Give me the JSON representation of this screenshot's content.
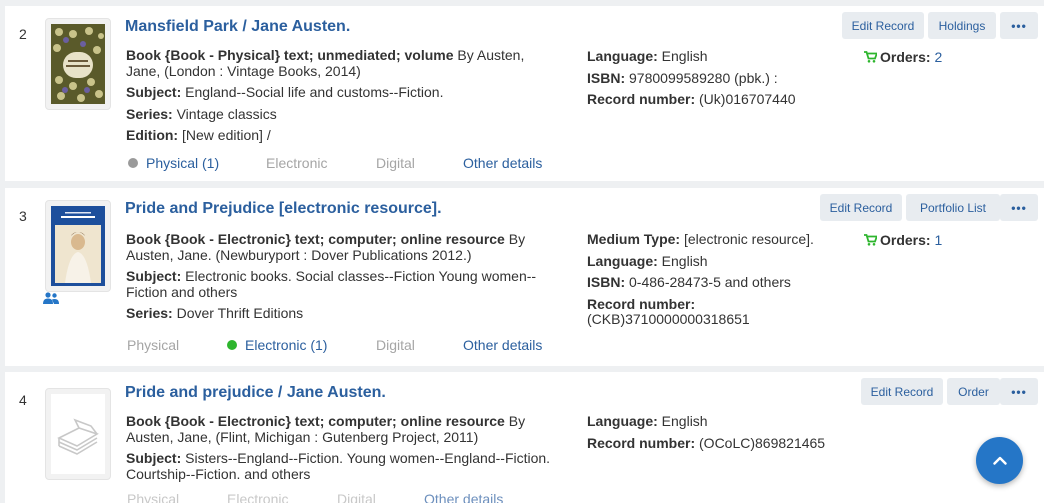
{
  "records": [
    {
      "index": "2",
      "title": "Mansfield Park / Jane Austen.",
      "format_label": "Book {Book - Physical} text; unmediated; volume",
      "format_rest": " By Austen, Jane, (London : Vintage Books, 2014)",
      "subject_label": "Subject:",
      "subject": " England--Social life and customs--Fiction.",
      "series_label": "Series:",
      "series": " Vintage classics",
      "edition_label": "Edition:",
      "edition": " [New edition] /",
      "language_label": "Language:",
      "language": " English",
      "isbn_label": "ISBN:",
      "isbn": " 9780099589280 (pbk.) :",
      "recnum_label": "Record number:",
      "recnum": " (Uk)016707440",
      "orders_label": "Orders:",
      "orders_count": "2",
      "tabs": {
        "physical": "Physical (1)",
        "electronic": "Electronic",
        "digital": "Digital",
        "other": "Other details"
      },
      "buttons": {
        "edit": "Edit Record",
        "second": "Holdings",
        "more": "•••"
      }
    },
    {
      "index": "3",
      "title": "Pride and Prejudice [electronic resource].",
      "format_label": "Book {Book - Electronic} text; computer; online resource",
      "format_rest": " By Austen, Jane. (Newburyport : Dover Publications 2012.)",
      "subject_label": "Subject:",
      "subject": " Electronic books. Social classes--Fiction Young women--Fiction and others",
      "series_label": "Series:",
      "series": " Dover Thrift Editions",
      "medium_label": "Medium Type:",
      "medium": " [electronic resource].",
      "language_label": "Language:",
      "language": " English",
      "isbn_label": "ISBN:",
      "isbn": " 0-486-28473-5 and others",
      "recnum_label": "Record number:",
      "recnum": "(CKB)3710000000318651",
      "orders_label": "Orders:",
      "orders_count": "1",
      "tabs": {
        "physical": "Physical",
        "electronic": "Electronic (1)",
        "digital": "Digital",
        "other": "Other details"
      },
      "buttons": {
        "edit": "Edit Record",
        "second": "Portfolio List",
        "more": "•••"
      }
    },
    {
      "index": "4",
      "title": "Pride and prejudice / Jane Austen.",
      "format_label": "Book {Book - Electronic} text; computer; online resource",
      "format_rest": " By Austen, Jane, (Flint, Michigan : Gutenberg Project, 2011)",
      "subject_label": "Subject:",
      "subject": " Sisters--England--Fiction. Young women--England--Fiction. Courtship--Fiction. and others",
      "language_label": "Language:",
      "language": " English",
      "recnum_label": "Record number:",
      "recnum": " (OCoLC)869821465",
      "tabs": {
        "physical": "Physical",
        "electronic": "Electronic",
        "digital": "Digital",
        "other": "Other details"
      },
      "buttons": {
        "edit": "Edit Record",
        "second": "Order",
        "more": "•••"
      }
    }
  ],
  "colors": {
    "link": "#2b5f9e",
    "accent": "#2576c7",
    "green": "#2db52d",
    "gray_dot": "#9a9a9a"
  },
  "icons": {
    "cart": "cart-icon",
    "people": "people-icon",
    "scroll": "chevron-up-icon"
  }
}
